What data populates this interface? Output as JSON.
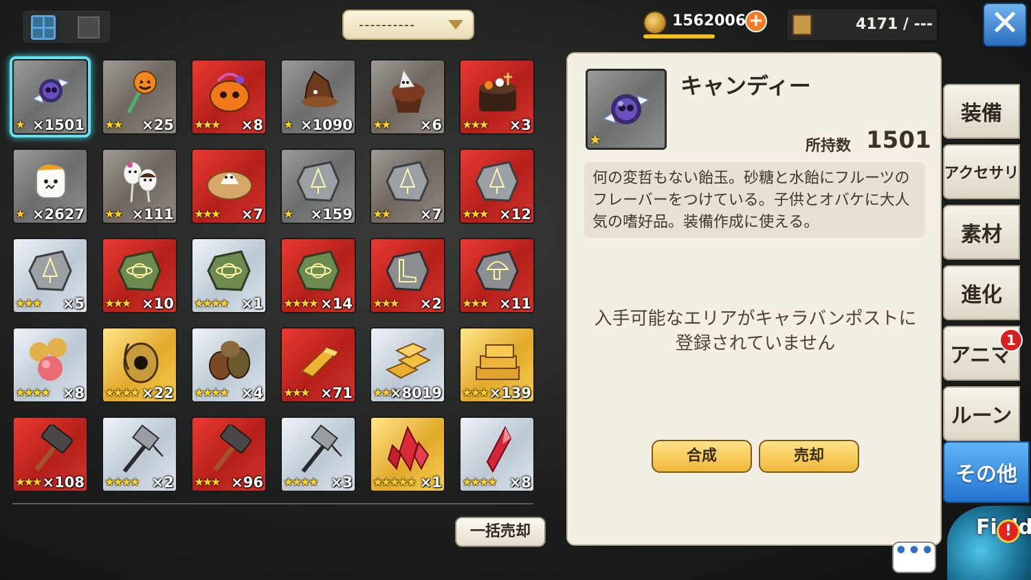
{
  "top_bar": {
    "filter_label": "----------",
    "gold": "1562006",
    "gold_add": "+",
    "capacity": "4171 / ---",
    "close": "✕"
  },
  "items": [
    {
      "name": "candy-item",
      "rarity": 1,
      "stars": "★",
      "count": "×1501",
      "icon": "candy-icon",
      "selected": true
    },
    {
      "name": "pumpkin-lollipop-item",
      "rarity": 2,
      "stars": "★★",
      "count": "×25",
      "icon": "pumpkin-lollipop-icon"
    },
    {
      "name": "pumpkin-basket-item",
      "rarity": 3,
      "stars": "★★★",
      "count": "×8",
      "icon": "pumpkin-basket-icon"
    },
    {
      "name": "chocolate-hat-item",
      "rarity": 1,
      "stars": "★",
      "count": "×1090",
      "icon": "chocolate-hat-icon"
    },
    {
      "name": "ghost-cupcake-item",
      "rarity": 2,
      "stars": "★★",
      "count": "×6",
      "icon": "cupcake-icon"
    },
    {
      "name": "halloween-cake-item",
      "rarity": 3,
      "stars": "★★★",
      "count": "×3",
      "icon": "cake-icon"
    },
    {
      "name": "marshmallow-item",
      "rarity": 1,
      "stars": "★",
      "count": "×2627",
      "icon": "marshmallow-icon"
    },
    {
      "name": "ghost-pops-item",
      "rarity": 2,
      "stars": "★★",
      "count": "×111",
      "icon": "ghost-pops-icon"
    },
    {
      "name": "ghost-pie-item",
      "rarity": 3,
      "stars": "★★★",
      "count": "×7",
      "icon": "pie-icon"
    },
    {
      "name": "tree-rune-gray-item",
      "rarity": 1,
      "stars": "★",
      "count": "×159",
      "icon": "tree-rune-icon"
    },
    {
      "name": "tree-rune-green-item",
      "rarity": 2,
      "stars": "★★",
      "count": "×7",
      "icon": "tree-rune-icon"
    },
    {
      "name": "tree-rune-blue-item",
      "rarity": 3,
      "stars": "★★★",
      "count": "×12",
      "icon": "tree-rune-icon"
    },
    {
      "name": "tree-rune-silver-item",
      "rarity": 4,
      "stars": "★★★",
      "count": "×5",
      "icon": "tree-rune-icon"
    },
    {
      "name": "planet-rune-green-item",
      "rarity": 3,
      "stars": "★★★",
      "count": "×10",
      "icon": "planet-rune-icon"
    },
    {
      "name": "planet-rune-blue-item",
      "rarity": 4,
      "stars": "★★★★",
      "count": "×1",
      "icon": "planet-rune-icon"
    },
    {
      "name": "planet-rune-blue2-item",
      "rarity": 3,
      "stars": "★★★★",
      "count": "×14",
      "icon": "planet-rune-icon"
    },
    {
      "name": "boot-rune-item",
      "rarity": 3,
      "stars": "★★★",
      "count": "×2",
      "icon": "boot-rune-icon"
    },
    {
      "name": "mushroom-rune-item",
      "rarity": 3,
      "stars": "★★★",
      "count": "×11",
      "icon": "mushroom-rune-icon"
    },
    {
      "name": "orbs-item",
      "rarity": 4,
      "stars": "★★★★",
      "count": "×8",
      "icon": "orbs-icon"
    },
    {
      "name": "gold-egg-item",
      "rarity": 5,
      "stars": "★★★★",
      "count": "×22",
      "icon": "gold-egg-icon"
    },
    {
      "name": "loot-bags-item",
      "rarity": 4,
      "stars": "★★★★",
      "count": "×4",
      "icon": "loot-bag-icon"
    },
    {
      "name": "gold-bar-item",
      "rarity": 3,
      "stars": "★★★",
      "count": "×71",
      "icon": "gold-bar-icon"
    },
    {
      "name": "gold-bars-item",
      "rarity": 4,
      "stars": "★★★",
      "count": "×8019",
      "icon": "gold-bars-icon"
    },
    {
      "name": "gold-stack-item",
      "rarity": 5,
      "stars": "★★★",
      "count": "×139",
      "icon": "gold-stack-icon"
    },
    {
      "name": "hammer-red-item",
      "rarity": 3,
      "stars": "★★★",
      "count": "×108",
      "icon": "hammer-icon"
    },
    {
      "name": "war-hammer-silver-item",
      "rarity": 4,
      "stars": "★★★★",
      "count": "×2",
      "icon": "war-hammer-icon"
    },
    {
      "name": "hammer-red2-item",
      "rarity": 3,
      "stars": "★★★",
      "count": "×96",
      "icon": "hammer-icon"
    },
    {
      "name": "war-hammer-silver2-item",
      "rarity": 4,
      "stars": "★★★★",
      "count": "×3",
      "icon": "war-hammer-icon"
    },
    {
      "name": "red-crystals-item",
      "rarity": 5,
      "stars": "★★★★★",
      "count": "×1",
      "icon": "crystals-icon"
    },
    {
      "name": "red-crystal-item",
      "rarity": 4,
      "stars": "★★★★",
      "count": "×8",
      "icon": "crystal-icon"
    }
  ],
  "bulk_sell": "一括売却",
  "detail": {
    "name": "キャンディー",
    "owned_label": "所持数",
    "owned_value": "1501",
    "stars": "★",
    "description": "何の変哲もない飴玉。砂糖と水飴にフルーツのフレーバーをつけている。子供とオバケに大人気の嗜好品。装備作成に使える。",
    "area_message_1": "入手可能なエリアがキャラバンポストに",
    "area_message_2": "登録されていません",
    "synthesize": "合成",
    "sell": "売却"
  },
  "side_tabs": [
    {
      "label": "装備"
    },
    {
      "label": "アクセサリ"
    },
    {
      "label": "素材"
    },
    {
      "label": "進化"
    },
    {
      "label": "アニマ"
    },
    {
      "label": "ルーン"
    },
    {
      "label": "その他",
      "active": true
    }
  ],
  "badge_anime": "1",
  "chat": "•••",
  "field": {
    "label": "Field",
    "alert": "!"
  },
  "colors": {
    "selected_glow": "#3fd3e6",
    "active_tab": "#2373d0",
    "accent_button": "#f2b83a"
  }
}
